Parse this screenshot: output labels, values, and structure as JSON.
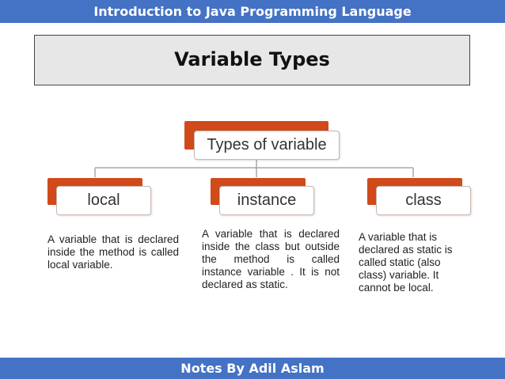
{
  "header": {
    "banner": "Introduction to Java Programming Language"
  },
  "slide": {
    "title": "Variable Types"
  },
  "diagram": {
    "root": {
      "label": "Types  of variable"
    },
    "children": [
      {
        "label": "local",
        "description": "A variable that is declared inside the method is called local variable."
      },
      {
        "label": "instance",
        "description": "A variable that is declared inside the class but outside the method is called instance variable . It is not declared as static."
      },
      {
        "label": "class",
        "description": "A variable that is declared as static is called static (also class) variable. It cannot be local."
      }
    ]
  },
  "footer": {
    "banner": "Notes By Adil Aslam"
  },
  "colors": {
    "banner": "#4472c4",
    "accent": "#d04a1a",
    "title_bg": "#e7e7e7"
  }
}
